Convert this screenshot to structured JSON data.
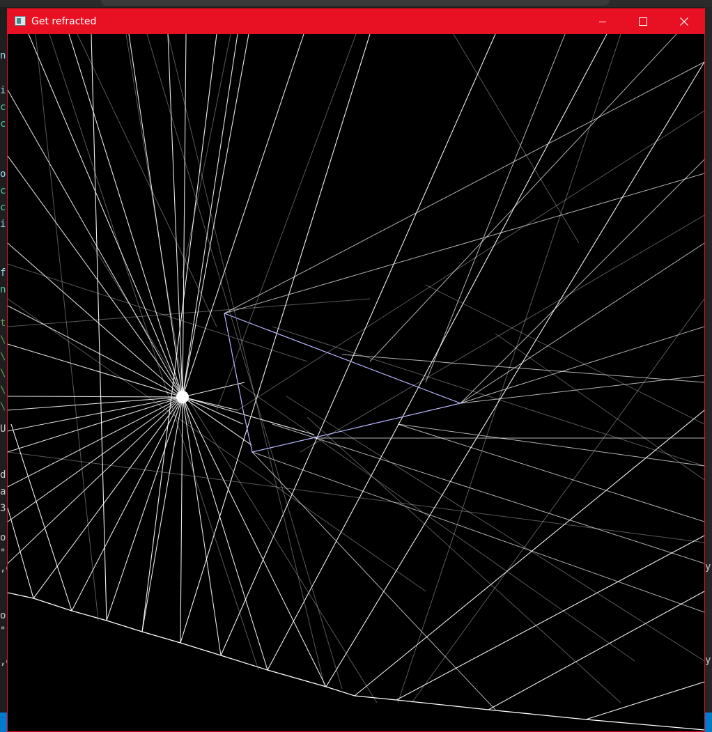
{
  "window": {
    "title": "Get refracted",
    "controls": {
      "minimize": "minimize-icon",
      "maximize": "maximize-icon",
      "close": "close-icon"
    },
    "accent_color": "#e81123"
  },
  "background_editor": {
    "left_fragments": [
      "n",
      "i",
      "c",
      "c",
      "o",
      "c",
      "c",
      "i",
      "f",
      "n",
      "t",
      "\\",
      "\\",
      "\\",
      "\\",
      "\\",
      "U",
      "d",
      "a",
      "3",
      "o",
      "\"",
      ",o",
      "o",
      "\"",
      ",o"
    ],
    "right_fragments": [
      "y",
      "y"
    ]
  },
  "scene": {
    "light_source_color": "#ffffff",
    "ray_color": "#ffffff",
    "prism_color": "#b8b8ff",
    "ground_color": "#ffffff"
  }
}
